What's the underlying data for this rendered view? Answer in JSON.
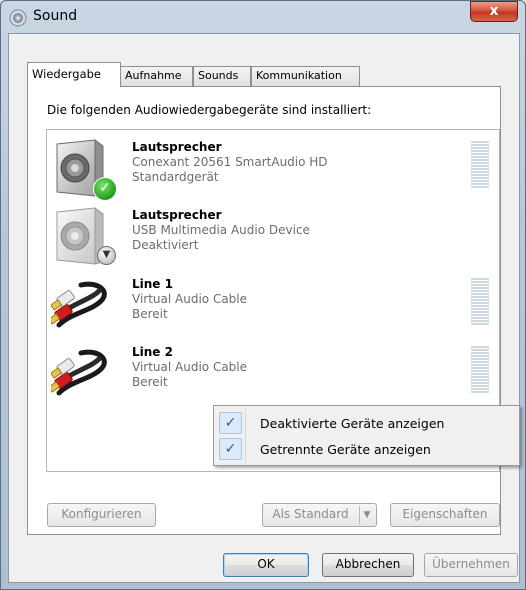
{
  "window": {
    "title": "Sound",
    "close_label": "x"
  },
  "tabs": [
    {
      "label": "Wiedergabe",
      "active": true
    },
    {
      "label": "Aufnahme",
      "active": false
    },
    {
      "label": "Sounds",
      "active": false
    },
    {
      "label": "Kommunikation",
      "active": false
    }
  ],
  "playback": {
    "description": "Die folgenden Audiowiedergabegeräte sind installiert:",
    "devices": [
      {
        "name": "Lautsprecher",
        "driver": "Conexant 20561 SmartAudio HD",
        "state": "Standardgerät",
        "icon": "speaker-icon",
        "status_icon": "default-device-check-icon",
        "meter": true
      },
      {
        "name": "Lautsprecher",
        "driver": "USB Multimedia Audio Device",
        "state": "Deaktiviert",
        "icon": "speaker-icon",
        "status_icon": "disabled-down-arrow-icon",
        "meter": false
      },
      {
        "name": "Line 1",
        "driver": "Virtual Audio Cable",
        "state": "Bereit",
        "icon": "rca-cable-icon",
        "meter": true
      },
      {
        "name": "Line 2",
        "driver": "Virtual Audio Cable",
        "state": "Bereit",
        "icon": "rca-cable-icon",
        "meter": true
      }
    ]
  },
  "context_menu": {
    "items": [
      {
        "label": "Deaktivierte Geräte anzeigen",
        "checked": true
      },
      {
        "label": "Getrennte Geräte anzeigen",
        "checked": true
      }
    ],
    "check_glyph": "✓"
  },
  "buttons": {
    "configure": "Konfigurieren",
    "set_default": "Als Standard",
    "properties": "Eigenschaften",
    "ok": "OK",
    "cancel": "Abbrechen",
    "apply": "Übernehmen"
  }
}
